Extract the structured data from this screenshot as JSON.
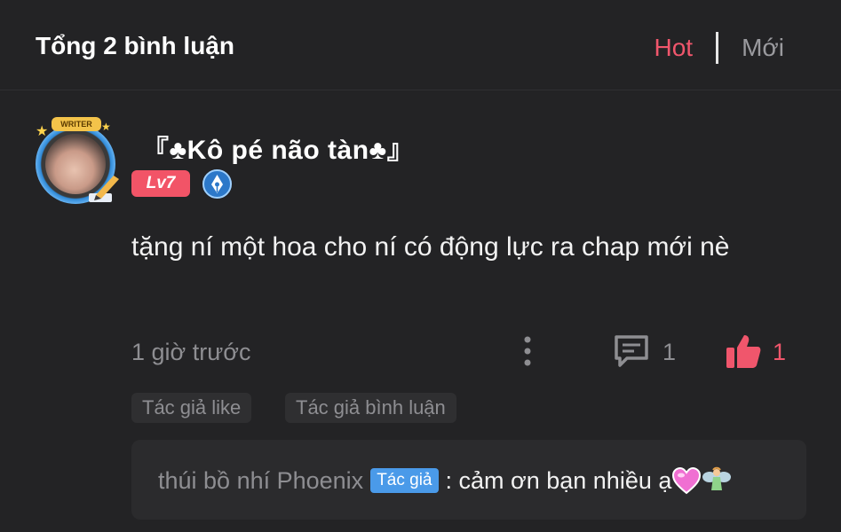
{
  "header": {
    "title": "Tổng 2 bình luận",
    "sort_hot": "Hot",
    "sort_new": "Mới",
    "active_sort": "Hot",
    "accent_color": "#f0566c"
  },
  "comment": {
    "avatar_badge": "WRITER",
    "username": "『♣Kô pé não tàn♣』",
    "level": "Lv7",
    "badge_icon": "pen-nib-icon",
    "text": "tặng ní một hoa cho ní có động lực ra chap mới nè",
    "time": "1 giờ trước",
    "reply_count": "1",
    "like_count": "1",
    "tags": [
      "Tác giả like",
      "Tác giả bình luận"
    ]
  },
  "reply": {
    "author": "thúi bồ nhí Phoenix",
    "author_badge": "Tác giả",
    "text": ": cảm ơn bạn nhiều ạ",
    "emojis": [
      "heart-icon",
      "fairy-icon"
    ]
  }
}
